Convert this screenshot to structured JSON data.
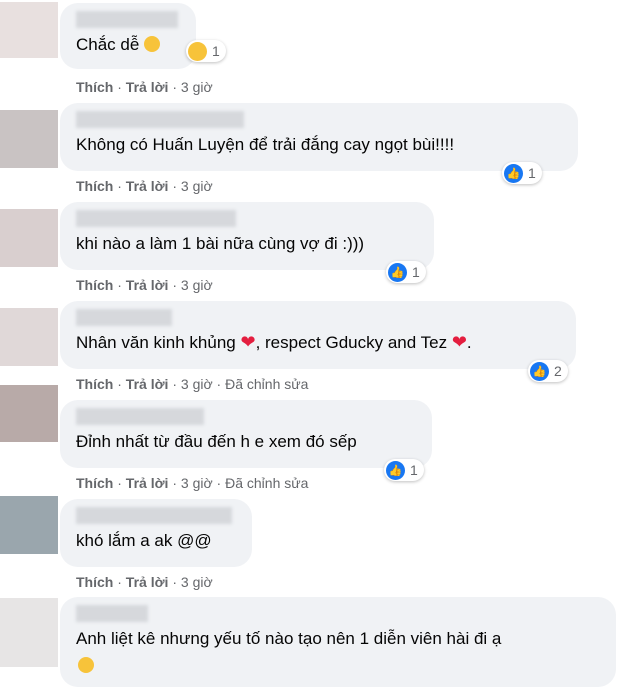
{
  "comments": [
    {
      "text": "Chắc dễ",
      "reaction_count": "1",
      "actions": {
        "like": "Thích",
        "reply": "Trả lời",
        "time": "3 giờ",
        "edited": ""
      }
    },
    {
      "text": "Không có Huấn Luyện để trải đắng cay ngọt bùi!!!!",
      "reaction_count": "1",
      "actions": {
        "like": "Thích",
        "reply": "Trả lời",
        "time": "3 giờ",
        "edited": ""
      }
    },
    {
      "text": "khi nào a làm 1 bài nữa cùng vợ đi :)))",
      "reaction_count": "1",
      "actions": {
        "like": "Thích",
        "reply": "Trả lời",
        "time": "3 giờ",
        "edited": ""
      }
    },
    {
      "text_a": "Nhân văn kinh khủng",
      "text_b": ", respect Gducky and Tez",
      "text_c": ".",
      "reaction_count": "2",
      "actions": {
        "like": "Thích",
        "reply": "Trả lời",
        "time": "3 giờ",
        "edited": "Đã chỉnh sửa"
      }
    },
    {
      "text": "Đỉnh nhất từ đầu đến h e xem đó sếp",
      "reaction_count": "1",
      "actions": {
        "like": "Thích",
        "reply": "Trả lời",
        "time": "3 giờ",
        "edited": "Đã chỉnh sửa"
      }
    },
    {
      "text": "khó lắm a ak @@",
      "reaction_count": "",
      "actions": {
        "like": "Thích",
        "reply": "Trả lời",
        "time": "3 giờ",
        "edited": ""
      }
    },
    {
      "text": "Anh liệt kê nhưng yếu tố nào tạo nên 1 diễn viên hài đi ạ",
      "reaction_count": "",
      "actions": {
        "like": "",
        "reply": "",
        "time": "",
        "edited": ""
      }
    }
  ],
  "separator": "·",
  "icons": {
    "like": "thumbs-up-icon",
    "haha": "laughing-emoji-icon",
    "heart": "heart-emoji-icon",
    "smile": "smile-emoji-icon"
  },
  "colors": {
    "bubble": "#f0f2f5",
    "meta": "#65676b",
    "like_blue": "#1877f2",
    "heart_red": "#e41e3f"
  }
}
